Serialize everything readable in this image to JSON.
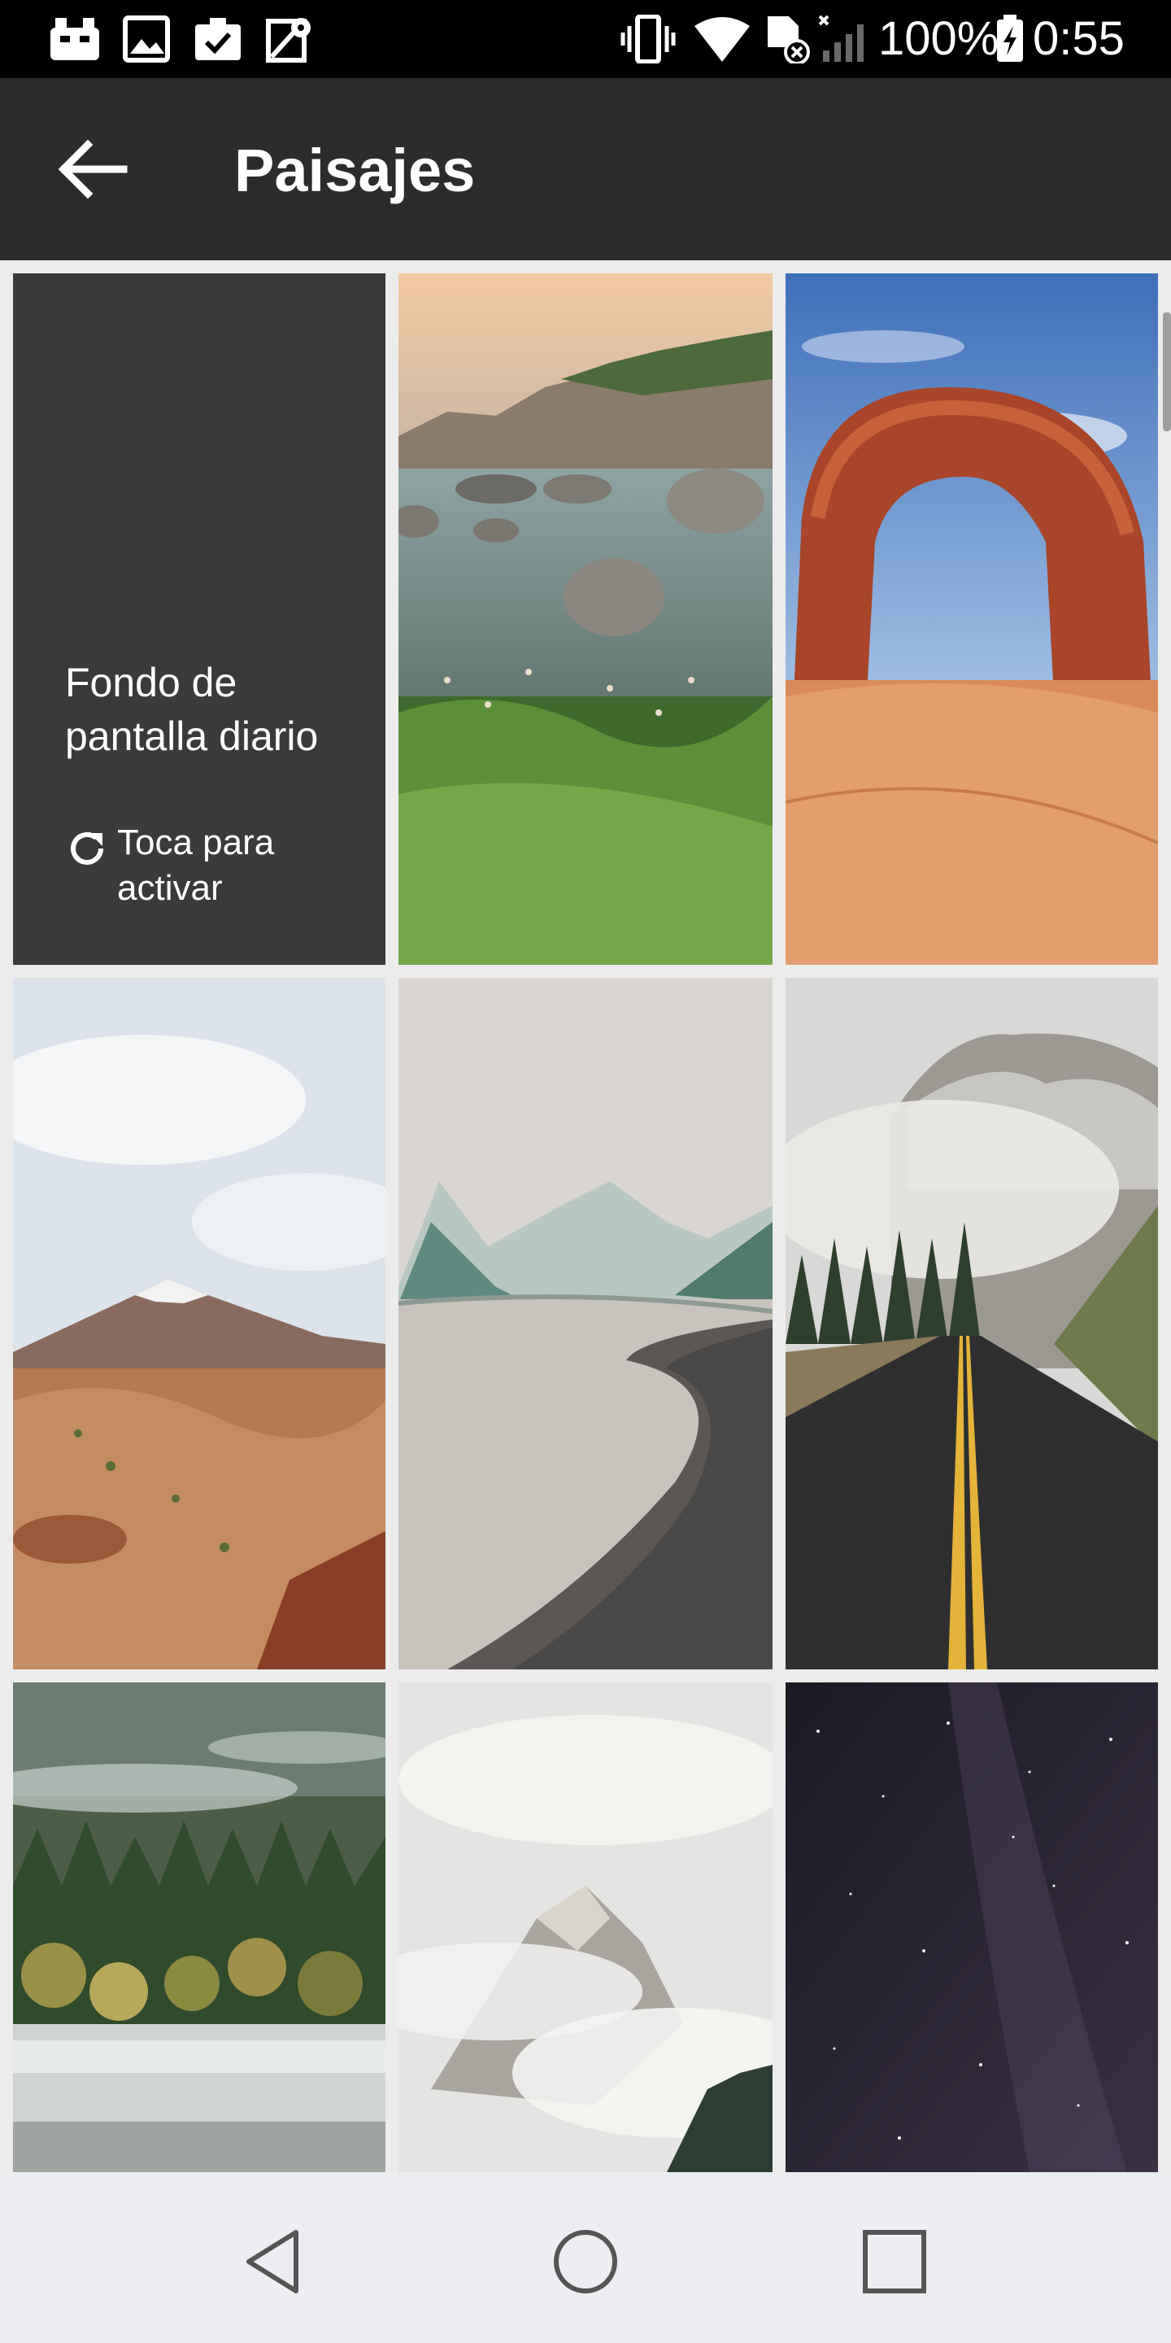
{
  "status_bar": {
    "battery": "100%",
    "time": "0:55",
    "left_icons": [
      "app-notification-icon",
      "gallery-icon",
      "clipboard-check-icon",
      "map-icon"
    ],
    "right_icons": [
      "vibrate-icon",
      "wifi-icon",
      "no-sim-icon",
      "signal-icon",
      "battery-charging-icon"
    ]
  },
  "app_bar": {
    "title": "Paisajes",
    "back_icon": "arrow-back-icon"
  },
  "daily_tile": {
    "title": "Fondo de pantalla diario",
    "action_label": "Toca para activar",
    "icon": "refresh-icon"
  },
  "wallpapers": [
    "rocky-lake-sunset",
    "red-rock-arch",
    "desert-volcano",
    "misty-lake-shore",
    "foggy-mountain-road",
    "misty-forest-lake",
    "cloudy-mountain-peak",
    "starry-night-sky"
  ],
  "nav_bar": {
    "icons": [
      "back-triangle-icon",
      "home-circle-icon",
      "recents-square-icon"
    ]
  },
  "colors": {
    "status_bar": "#000000",
    "app_bar": "#2c2c2c",
    "grid_background": "#ececec",
    "daily_tile": "#3a3a3a",
    "nav_bar": "#eceef2"
  }
}
